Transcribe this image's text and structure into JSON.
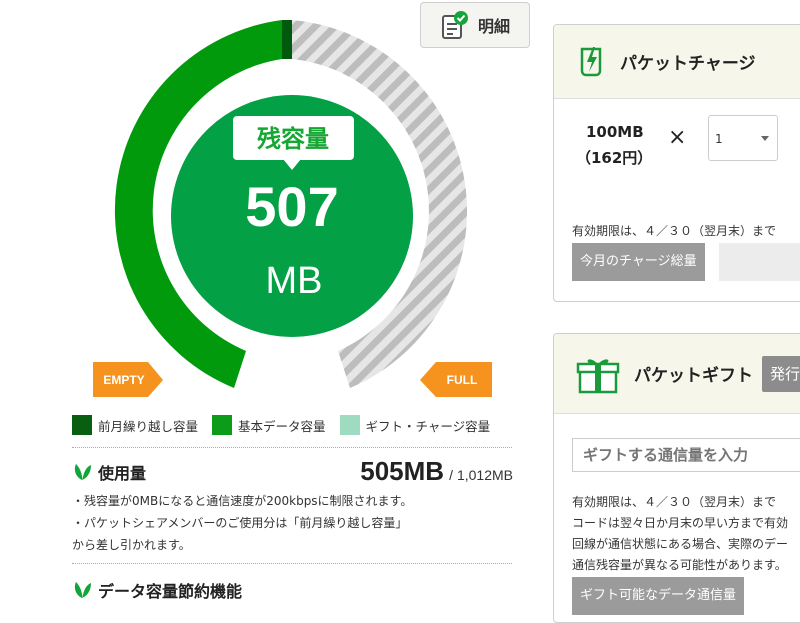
{
  "gauge": {
    "label": "残容量",
    "value": "507",
    "unit": "MB",
    "empty_label": "EMPTY",
    "full_label": "FULL",
    "remaining_fraction": 0.5,
    "colors": {
      "carryover": "#005a0e",
      "basic": "#009a0c",
      "gift": "#cfcfcf",
      "center": "#03a046"
    }
  },
  "detail_button": {
    "label": "明細",
    "icon": "document-check-icon"
  },
  "legend": [
    {
      "label": "前月繰り越し容量",
      "color": "#0a5e12"
    },
    {
      "label": "基本データ容量",
      "color": "#0c9c1a"
    },
    {
      "label": "ギフト・チャージ容量",
      "color": "#9edbc0"
    }
  ],
  "usage": {
    "title": "使用量",
    "used": "505MB",
    "total": "/ 1,012MB",
    "notes": [
      "・残容量が0MBになると通信速度が200kbpsに制限されます。",
      "・パケットシェアメンバーのご使用分は「前月繰り越し容量」",
      "から差し引かれます。"
    ]
  },
  "saving": {
    "title": "データ容量節約機能"
  },
  "charge": {
    "title": "パケットチャージ",
    "amount": "100MB",
    "price": "（162円）",
    "times": "×",
    "quantity": "1",
    "expiry_note": "有効期限は、４／３０（翌月末）まで",
    "monthly_total": "今月のチャージ総量"
  },
  "gift": {
    "title": "パケットギフト",
    "issue_label": "発行",
    "input_placeholder": "ギフトする通信量を入力",
    "notes": [
      "有効期限は、４／３０（翌月末）まで",
      "コードは翌々日か月末の早い方まで有効",
      "回線が通信状態にある場合、実際のデー",
      "通信残容量が異なる可能性があります。"
    ],
    "available_label": "ギフト可能なデータ通信量"
  }
}
